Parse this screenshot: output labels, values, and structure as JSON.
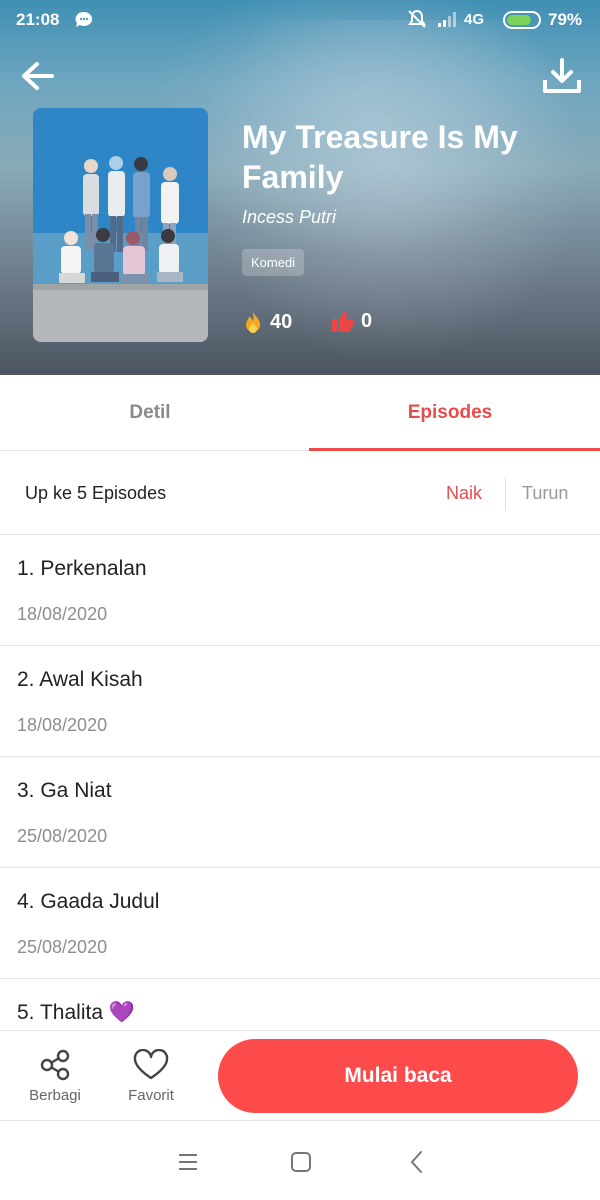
{
  "status_bar": {
    "time": "21:08",
    "network": "4G",
    "battery_percent": "79%",
    "battery_level": 0.79
  },
  "book": {
    "title": "My Treasure Is My Family",
    "author": "Incess Putri",
    "genre": "Komedi",
    "likes": "40",
    "dislikes": "0"
  },
  "tabs": {
    "detail": "Detil",
    "episodes": "Episodes",
    "active": "episodes"
  },
  "sort": {
    "summary": "Up ke 5 Episodes",
    "ascending": "Naik",
    "descending": "Turun",
    "active": "ascending"
  },
  "episodes": [
    {
      "title": "1. Perkenalan",
      "date": "18/08/2020"
    },
    {
      "title": "2. Awal Kisah",
      "date": "18/08/2020"
    },
    {
      "title": "3. Ga Niat",
      "date": "25/08/2020"
    },
    {
      "title": "4. Gaada Judul",
      "date": "25/08/2020"
    },
    {
      "title": "5. Thalita 💜",
      "date": ""
    }
  ],
  "actions": {
    "share": "Berbagi",
    "favorite": "Favorit",
    "start_reading": "Mulai baca"
  },
  "icons": {
    "back": "arrow-left-icon",
    "download": "download-icon",
    "likes": "fire-icon",
    "dislikes": "thumbs-down-icon",
    "share": "share-icon",
    "favorite": "heart-icon",
    "nav_menu": "menu-icon",
    "nav_home": "home-square-icon",
    "nav_back": "chevron-left-icon"
  },
  "colors": {
    "accent": "#ef4a4a",
    "button": "#fd4a4a",
    "muted_text": "#8e8e8e"
  }
}
